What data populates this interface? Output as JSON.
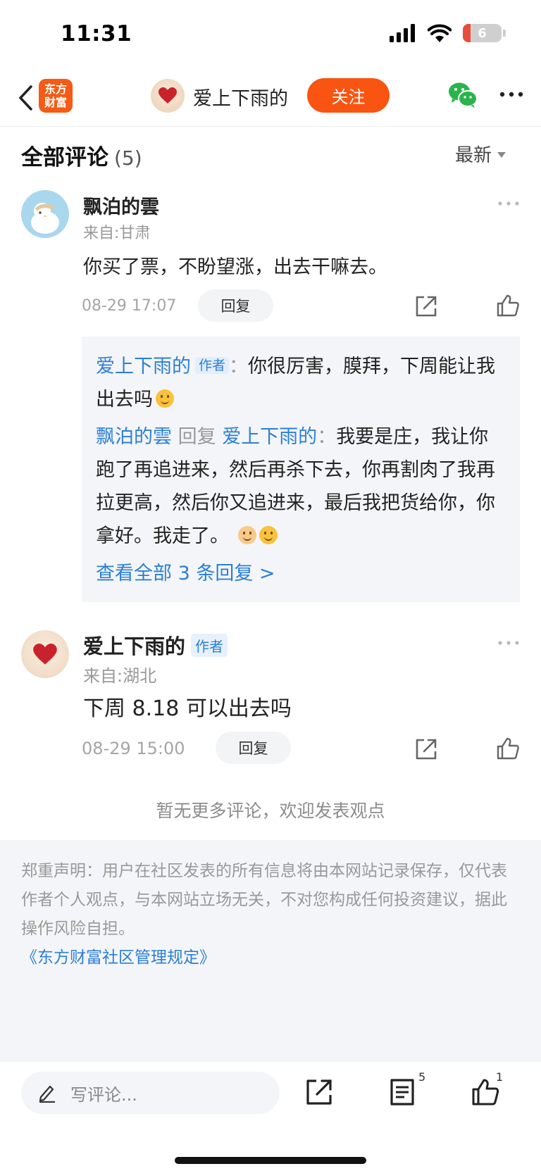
{
  "status_bar": {
    "time": "11:31",
    "battery_text": "6",
    "battery_percent": 6
  },
  "nav": {
    "app_logo_line1": "东方",
    "app_logo_line2": "财富",
    "username": "爱上下雨的",
    "follow_label": "关注",
    "icons": [
      "back-chevron-icon",
      "wechat-icon",
      "more-icon"
    ]
  },
  "comments_section": {
    "title": "全部评论",
    "count": "(5)",
    "sort_label": "最新"
  },
  "comments": [
    {
      "name": "飘泊的雲",
      "location": "来自:甘肃",
      "text": "你买了票，不盼望涨，出去干嘛去。",
      "time": "08-29 17:07",
      "reply_label": "回复",
      "replies": [
        {
          "from": "爱上下雨的",
          "badge": "作者",
          "sep": "：",
          "text": "你很厉害，膜拜，下周能让我出去吗"
        },
        {
          "from": "飘泊的雲",
          "reply_word": "回复",
          "to": "爱上下雨的",
          "sep": "：",
          "text": "我要是庄，我让你跑了再追进来，然后再杀下去，你再割肉了我再拉更高，然后你又追进来，最后我把货给你，你拿好。我走了。"
        }
      ],
      "view_all": "查看全部 3 条回复 >"
    },
    {
      "name": "爱上下雨的",
      "badge": "作者",
      "location": "来自:湖北",
      "text": "下周 8.18 可以出去吗",
      "time": "08-29 15:00",
      "reply_label": "回复"
    }
  ],
  "no_more_text": "暂无更多评论，欢迎发表观点",
  "disclaimer": {
    "text": "郑重声明：用户在社区发表的所有信息将由本网站记录保存，仅代表作者个人观点，与本网站立场无关，不对您构成任何投资建议，据此操作风险自担。",
    "link": "《东方财富社区管理规定》"
  },
  "bottom_bar": {
    "input_placeholder": "写评论...",
    "comment_count": "5",
    "like_count": "1"
  },
  "colors": {
    "accent_orange": "#fa5412",
    "link_blue": "#2b7fd8",
    "battery_red": "#e74c3c"
  }
}
